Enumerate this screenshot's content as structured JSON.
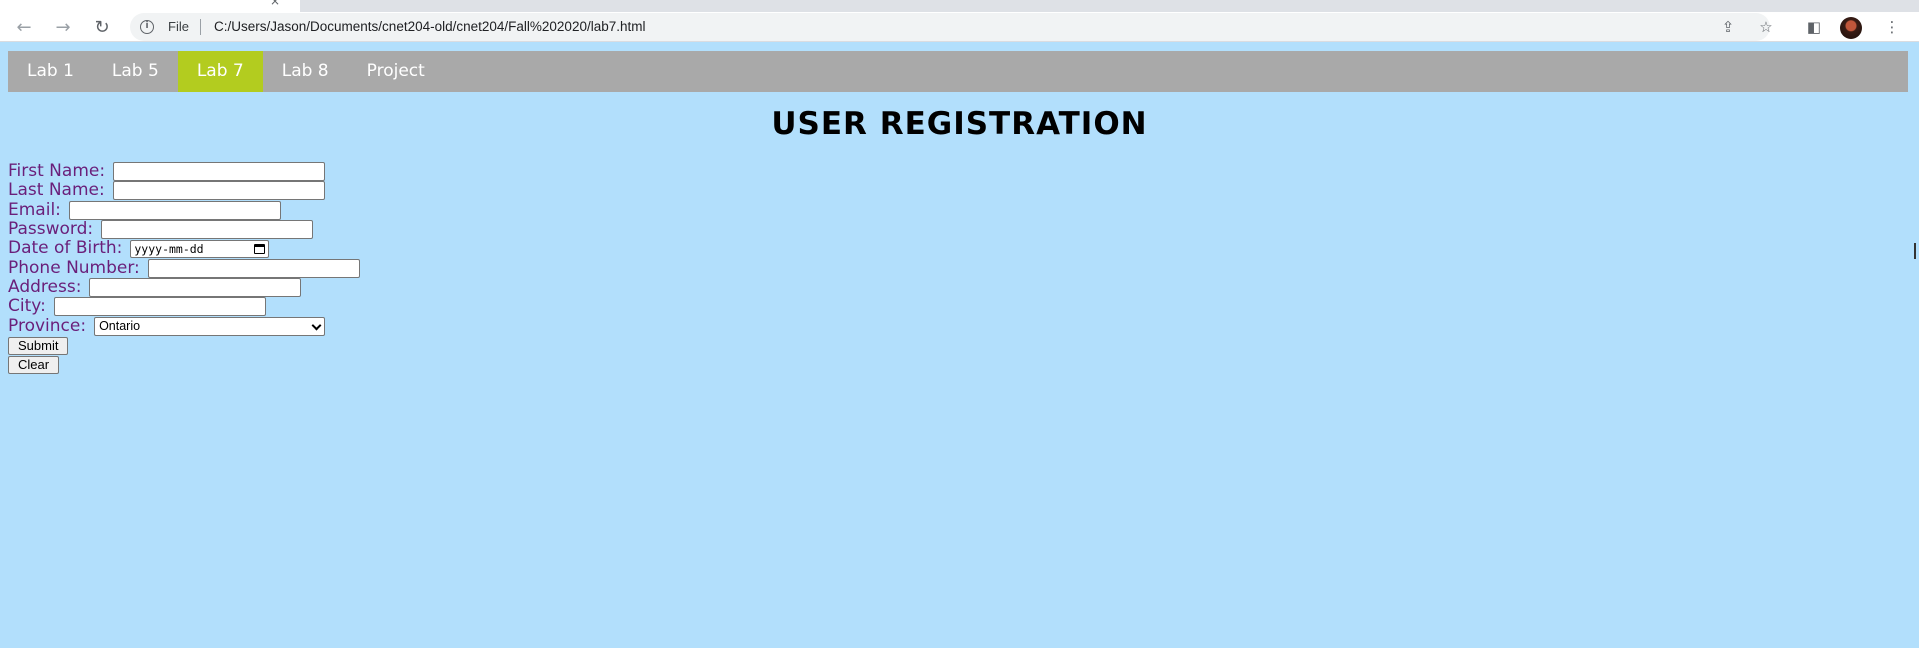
{
  "browser": {
    "tab_close": "×",
    "back": "←",
    "forward": "→",
    "reload": "↻",
    "scheme_label": "File",
    "url": "C:/Users/Jason/Documents/cnet204-old/cnet204/Fall%202020/lab7.html",
    "share": "⇪",
    "star": "☆",
    "side_panel": "◧",
    "menu": "⋮"
  },
  "nav": {
    "items": [
      {
        "label": "Lab 1"
      },
      {
        "label": "Lab 5"
      },
      {
        "label": "Lab 7"
      },
      {
        "label": "Lab 8"
      },
      {
        "label": "Project"
      }
    ],
    "active_index": 2,
    "active_color": "#b3cc1f",
    "bar_color": "#a9a9a9"
  },
  "page": {
    "title": "USER REGISTRATION",
    "background": "#b2dffc"
  },
  "form": {
    "first_name_label": "First Name:",
    "last_name_label": "Last Name:",
    "email_label": "Email:",
    "password_label": "Password:",
    "dob_label": "Date of Birth:",
    "dob_placeholder": "yyyy-mm-dd",
    "phone_label": "Phone Number:",
    "address_label": "Address:",
    "city_label": "City:",
    "province_label": "Province:",
    "province_selected": "Ontario",
    "submit_label": "Submit",
    "clear_label": "Clear",
    "label_color": "#6a1f7a"
  }
}
